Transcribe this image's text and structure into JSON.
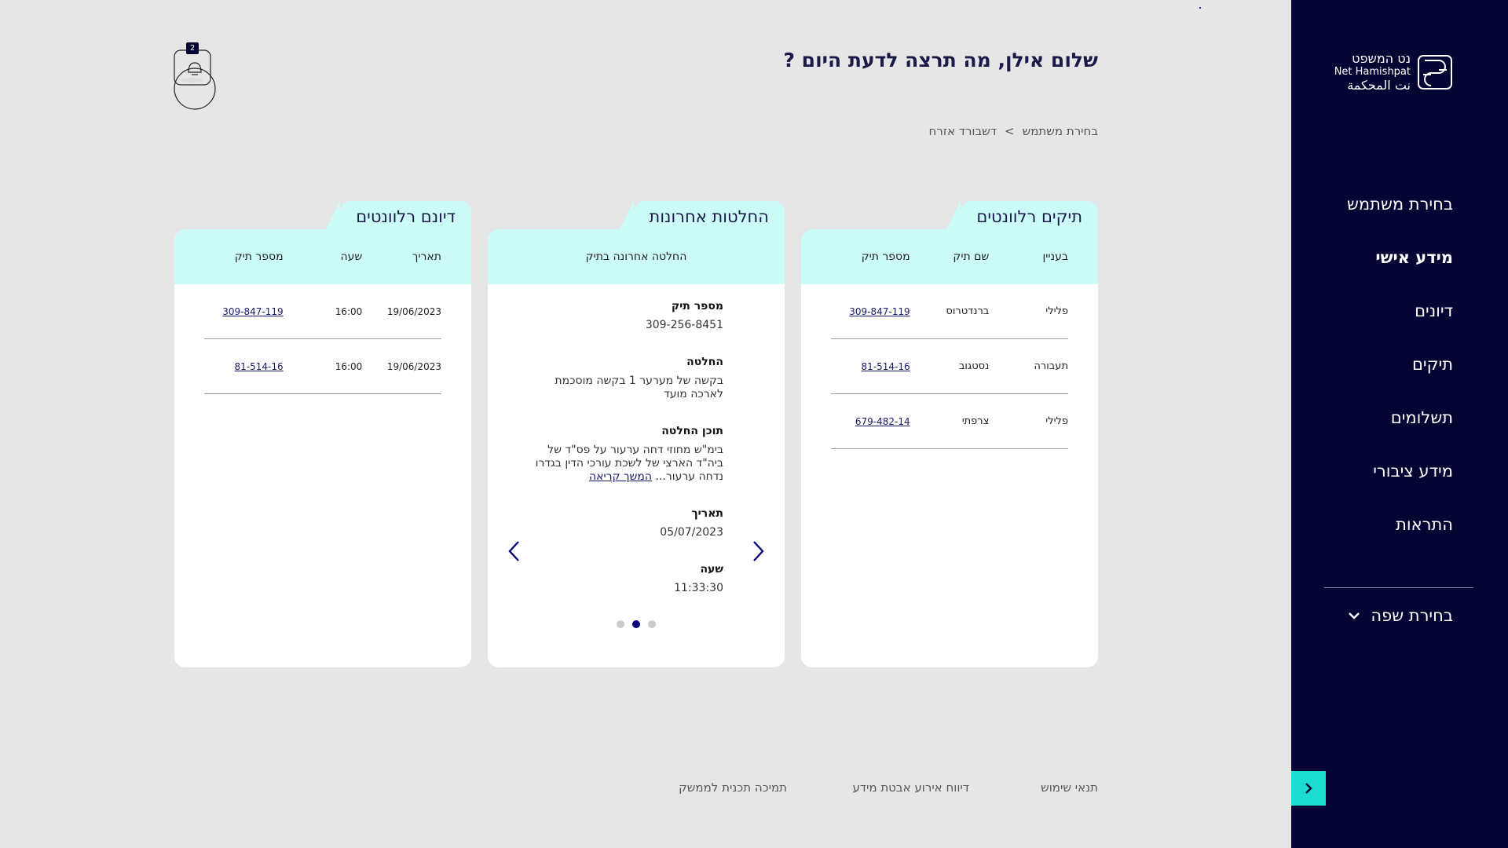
{
  "sidebar": {
    "logo": {
      "line1": "נט המשפט",
      "line2": "Net Hamishpat",
      "line3": "نت المحكمة"
    },
    "items": [
      {
        "label": "בחירת משתמש"
      },
      {
        "label": "מידע אישי"
      },
      {
        "label": "דיונים"
      },
      {
        "label": "תיקים"
      },
      {
        "label": "תשלומים"
      },
      {
        "label": "מידע ציבורי"
      },
      {
        "label": "התראות"
      }
    ],
    "active_index": 1,
    "language_label": "בחירת שפה"
  },
  "header": {
    "greeting": "שלום אילן, מה תרצה לדעת היום ?",
    "breadcrumb": {
      "first": "בחירת משתמש",
      "separator": ">",
      "second": "דשבורד אזרח"
    },
    "notifications_count": "2"
  },
  "cases_card": {
    "title": "תיקים רלוונטים",
    "columns": [
      "בעניין",
      "שם תיק",
      "מספר תיק"
    ],
    "rows": [
      {
        "subject": "פלילי",
        "name": "ברנדטרוס",
        "number": "309-847-119"
      },
      {
        "subject": "תעבורה",
        "name": "נסטגוב",
        "number": "81-514-16"
      },
      {
        "subject": "פלילי",
        "name": "צרפתי",
        "number": "679-482-14"
      }
    ]
  },
  "decisions_card": {
    "title": "החלטות אחרונות",
    "header": "החלטה אחרונה בתיק",
    "case_label": "מספר תיק",
    "case_value": "309-256-8451",
    "decision_label": "החלטה",
    "decision_value": "בקשה של מערער 1 בקשה מוסכמת לארכה מועד",
    "content_label": "תוכן החלטה",
    "content_value": "בימ\"ש מחוזי דחה ערעור על פס\"ד של ביה\"ד הארצי של לשכת עורכי הדין בגדרו נדחה ערעור...",
    "read_more": "המשך קריאה",
    "date_label": "תאריך",
    "date_value": "05/07/2023",
    "time_label": "שעה",
    "time_value": "11:33:30",
    "active_slide": 1,
    "slide_count": 3
  },
  "hearings_card": {
    "title": "דיונם רלוונטים",
    "columns": [
      "תאריך",
      "שעה",
      "מספר תיק"
    ],
    "rows": [
      {
        "date": "19/06/2023",
        "time": "16:00",
        "number": "309-847-119"
      },
      {
        "date": "19/06/2023",
        "time": "16:00",
        "number": "81-514-16"
      }
    ]
  },
  "footer": {
    "terms": "תנאי שימוש",
    "report": "דיווח אירוע אבטת מידע",
    "support": "תמיכה תכנית לממשק"
  },
  "colors": {
    "sidebar": "#050533",
    "card_header": "#ccfcf8",
    "accent": "#1ddcd0",
    "background": "#e6e6e6"
  }
}
